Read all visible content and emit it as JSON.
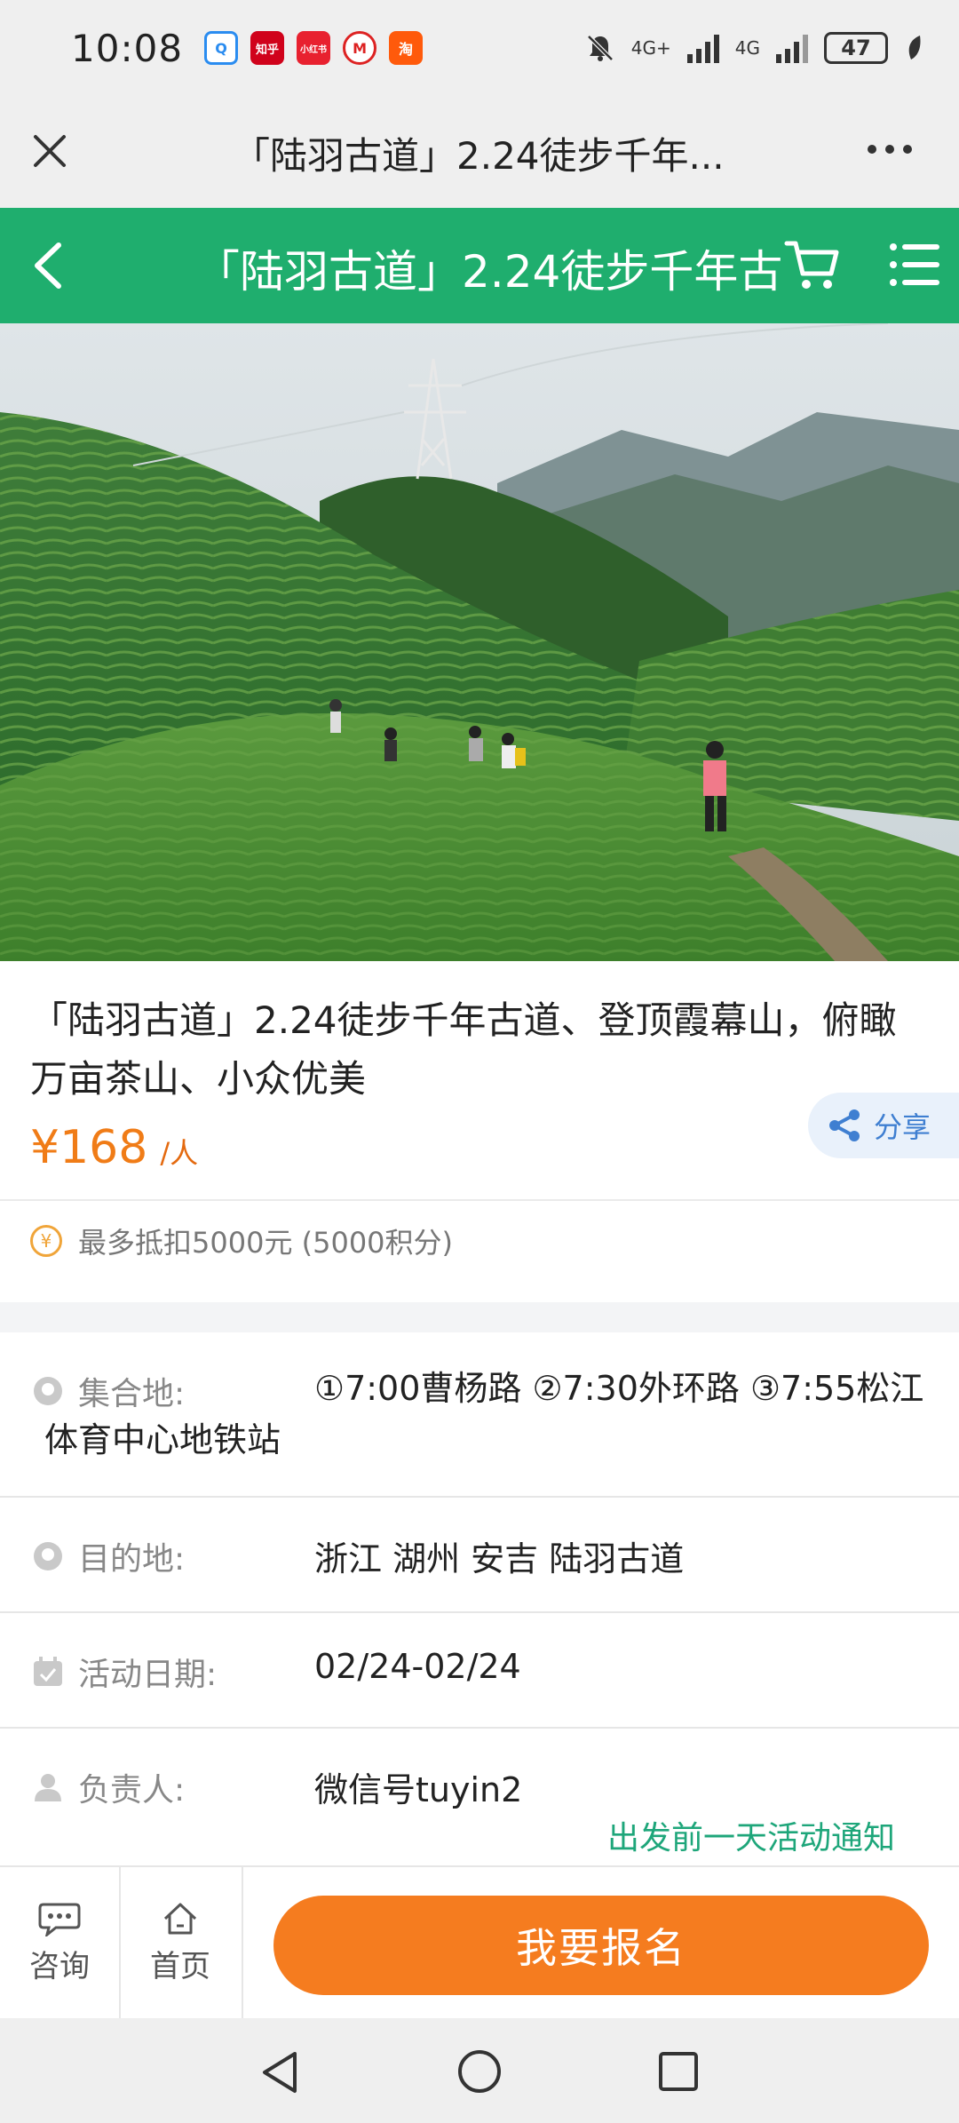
{
  "status_bar": {
    "time": "10:08",
    "apps": [
      {
        "name": "qq-browser-icon",
        "glyph": "Q",
        "color": "#2a8cf0"
      },
      {
        "name": "zhihu-app-icon",
        "glyph": "知乎",
        "color": "#d0021b"
      },
      {
        "name": "xiaohongshu-icon",
        "glyph": "小红书",
        "color": "#e8212f"
      },
      {
        "name": "metro-icon",
        "glyph": "M",
        "color": "#d22"
      },
      {
        "name": "taobao-icon",
        "glyph": "淘",
        "color": "#ff5a0b"
      }
    ],
    "network_1": "4G+",
    "network_2": "4G",
    "battery": "47"
  },
  "browser": {
    "title": "「陆羽古道」2.24徒步千年..."
  },
  "header": {
    "title": "「陆羽古道」2.24徒步千年古"
  },
  "product": {
    "title": "「陆羽古道」2.24徒步千年古道、登顶霞幕山，俯瞰万亩茶山、小众优美",
    "price": "¥168",
    "price_unit": "/人",
    "share_label": "分享",
    "points_text": "最多抵扣5000元 (5000积分)"
  },
  "info": {
    "assemble_label": "集合地:",
    "assemble_value": "①7:00曹杨路 ②7:30外环路 ③7:55松江体育中心地铁站",
    "destination_label": "目的地:",
    "destination_value": "浙江 湖州 安吉 陆羽古道",
    "date_label": "活动日期:",
    "date_value": "02/24-02/24",
    "leader_label": "负责人:",
    "leader_value": "微信号tuyin2",
    "notice": "出发前一天活动通知"
  },
  "bottom_bar": {
    "consult_label": "咨询",
    "home_label": "首页",
    "signup_label": "我要报名"
  },
  "colors": {
    "brand_green": "#1fae6e",
    "accent_orange": "#f57c1f",
    "price_orange": "#f07c17"
  }
}
